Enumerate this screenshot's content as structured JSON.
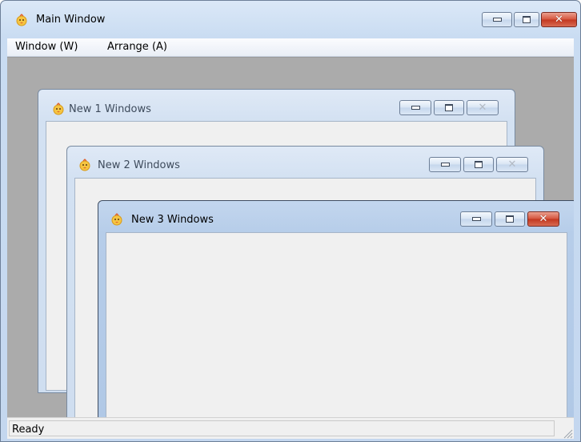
{
  "main_window": {
    "title": "Main Window",
    "icon": "app-chick-icon"
  },
  "menu": {
    "items": [
      {
        "label": "Window (W)"
      },
      {
        "label": "Arrange (A)"
      }
    ]
  },
  "child_windows": [
    {
      "title": "New 1 Windows",
      "active": false
    },
    {
      "title": "New 2 Windows",
      "active": false
    },
    {
      "title": "New 3 Windows",
      "active": true
    }
  ],
  "status_bar": {
    "text": "Ready"
  },
  "colors": {
    "mdi_background": "#ababab",
    "close_button_active": "#c9412a",
    "client_area": "#f0f0f0"
  }
}
